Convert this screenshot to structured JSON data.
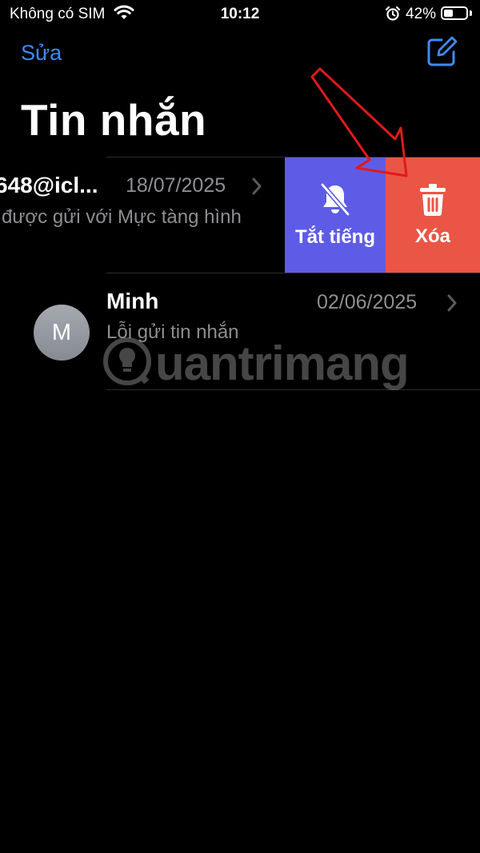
{
  "status_bar": {
    "carrier": "Không có SIM",
    "time": "10:12",
    "battery_percent": "42%",
    "battery_level": 0.42,
    "icons": [
      "wifi-icon",
      "alarm-icon",
      "battery-icon"
    ]
  },
  "nav": {
    "edit_label": "Sửa",
    "compose_icon": "compose-icon",
    "title": "Tin nhắn"
  },
  "conversations": [
    {
      "name": "648@icl...",
      "date": "18/07/2025",
      "preview": "được gửi với Mực tàng hình",
      "swiped": true
    },
    {
      "name": "Minh",
      "avatar_initial": "M",
      "date": "02/06/2025",
      "preview": "Lỗi gửi tin nhắn"
    }
  ],
  "swipe_actions": {
    "mute_label": "Tắt tiếng",
    "mute_icon": "bell-slash-icon",
    "delete_label": "Xóa",
    "delete_icon": "trash-icon"
  },
  "watermark": {
    "text": "uantrimang"
  },
  "colors": {
    "accent": "#3e8bf4",
    "mute": "#5e5ce6",
    "delete": "#eb5545",
    "annotation_arrow": "#e01a1a"
  }
}
